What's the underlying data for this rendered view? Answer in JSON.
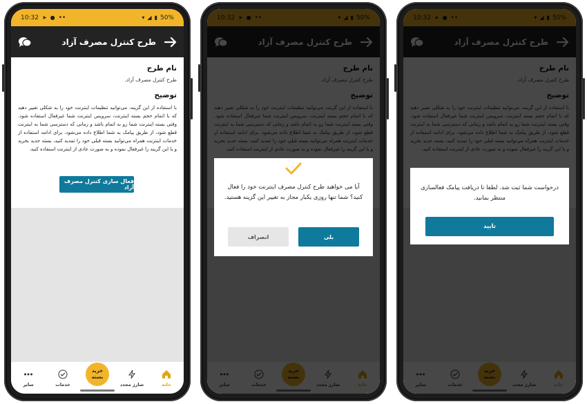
{
  "status_bar": {
    "time": "10:32",
    "dots": "••",
    "battery": "50%"
  },
  "app_bar": {
    "title": "طرح کنترل مصرف آزاد"
  },
  "plan": {
    "name_heading": "نام طرح",
    "name_value": "طرح کنترل مصرف آزاد.",
    "description_heading": "توضیح",
    "description": "با استفاده از این گزینه، می‌توانید تنظیمات اینترنت خود را به شکلی تغییر دهید که با اتمام حجم بسته اینترنت، سرویس اینترنت شما غیرفعال استفاده شود. وقتی بسته اینترنت شما رو به اتمام باشد و زمانی که دسترسی شما به اینترنت قطع شود، از طریق پیامک به شما اطلاع داده می‌شود. برای ادامه استفاده از خدمات اینترنت همراه می‌توانید بسته قبلی خود را تمدید کنید، بسته جدید بخرید و یا این گزینه را غیرفعال نموده و به صورت عادی از اینترنت استفاده کنید.",
    "activate_button": "فعال سازی کنترل مصرف آزاد"
  },
  "bottom_nav": {
    "home": "خانه",
    "recharge": "شارژ مجدد",
    "buy_package": "خرید بسته",
    "services": "خدمات",
    "more": "سایر"
  },
  "confirm_dialog": {
    "message": "آیا می خواهید طرح کنترل مصرف اینترنت خود را فعال کنید؟ شما تنها روزی یکبار مجاز به تغییر این گزینه هستید.",
    "yes": "بلی",
    "cancel": "انصراف"
  },
  "info_dialog": {
    "message": "درخواست شما ثبت شد. لطفا تا دریافت پیامک فعالسازی منتظر بمانید.",
    "ok": "تایید"
  },
  "colors": {
    "accent_yellow": "#f2b52a",
    "primary_blue": "#0f7a9c",
    "app_bar": "#232323"
  }
}
